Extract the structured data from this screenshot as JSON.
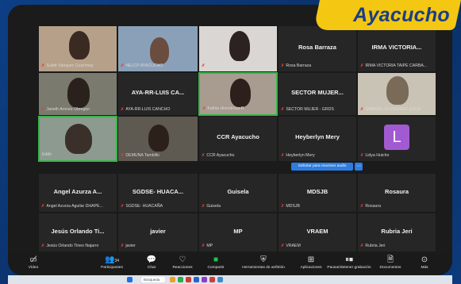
{
  "badge": {
    "text": "Ayacucho"
  },
  "tiles": [
    {
      "label": "Sulett Vásquez Cusirimay"
    },
    {
      "label": "NELCP AYACUCHO"
    },
    {
      "label": "CDJ Ayacucho"
    },
    {
      "name": "Rosa Barraza",
      "label": "Rosa Barraza"
    },
    {
      "name": "IRMA VICTORIA...",
      "label": "IRMA VICTORIA TAIPE CARBA..."
    },
    {
      "label": "Janeth Arones Obregon"
    },
    {
      "name": "AYA-RR-LUIS CA...",
      "label": "AYA-RR-LUIS CANCHO"
    },
    {
      "label": "Kathia Hinostroza R."
    },
    {
      "name": "SECTOR MUJER...",
      "label": "SECTOR MUJER - GRDS"
    },
    {
      "label": "GABRIEL GUTIERREZ EGOA"
    },
    {
      "label": "Edith"
    },
    {
      "label": "DEMUNA Tambillo"
    },
    {
      "name": "CCR Ayacucho",
      "label": "CCR Ayacucho"
    },
    {
      "name": "Heyberlyn Mery",
      "label": "Heyberlyn Mery"
    },
    {
      "label": "Lidya Huicho",
      "avatar": "L"
    },
    {
      "name": "Angel Azurza A...",
      "label": "Angel Azurza Aguilar DHAPE..."
    },
    {
      "name": "SGDSE- HUACA...",
      "label": "SGDSE- HUACAÑA"
    },
    {
      "name": "Guisela",
      "label": "Guisela"
    },
    {
      "name": "MDSJB",
      "label": "MDSJB"
    },
    {
      "name": "Rosaura",
      "label": "Rosaura"
    },
    {
      "name": "Jesús Orlando Ti...",
      "label": "Jesús Orlando Tineo Najarro"
    },
    {
      "name": "javier",
      "label": "javier"
    },
    {
      "name": "MP",
      "label": "MP"
    },
    {
      "name": "VRAEM",
      "label": "VRAEM"
    },
    {
      "name": "Rubria Jeri",
      "label": "Rubria Jeri"
    }
  ],
  "request_button": "Solicitar para reactivar audio",
  "toolbar": {
    "video": "Vídeo",
    "participants": "Participantes",
    "participants_count": "34",
    "chat": "Chat",
    "reactions": "Reacciones",
    "share": "Compartir",
    "whiteboard": "Herramientas de anfitrión",
    "apps": "Aplicaciones",
    "recording": "Pausar/detener grabación",
    "documents": "Documentos",
    "more": "Más"
  },
  "taskbar": {
    "search": "Búsqueda"
  },
  "colors": {
    "badge": "#f3c712",
    "badge_text": "#1a3e86",
    "active_speaker": "#39b54a",
    "share_green": "#27c24c"
  }
}
